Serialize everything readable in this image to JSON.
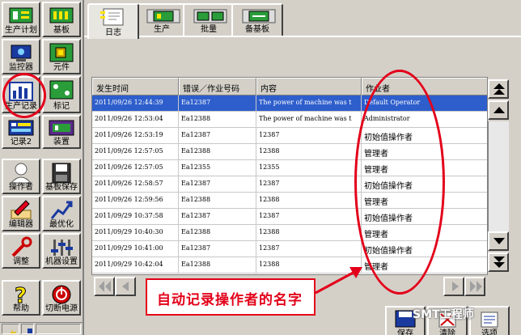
{
  "sidebar": {
    "buttons": [
      {
        "label": "生产计划",
        "icon": "production-plan-icon"
      },
      {
        "label": "基板",
        "icon": "board-icon"
      },
      {
        "label": "监控器",
        "icon": "monitor-icon"
      },
      {
        "label": "元件",
        "icon": "component-icon"
      },
      {
        "label": "生产记录",
        "icon": "production-record-icon"
      },
      {
        "label": "标记",
        "icon": "mark-icon"
      },
      {
        "label": "记录2",
        "icon": "record2-icon"
      },
      {
        "label": "装置",
        "icon": "device-icon"
      },
      {
        "label": "操作者",
        "icon": "operator-icon"
      },
      {
        "label": "基板保存",
        "icon": "save-board-icon"
      },
      {
        "label": "编辑器",
        "icon": "editor-icon"
      },
      {
        "label": "最优化",
        "icon": "optimize-icon"
      },
      {
        "label": "调整",
        "icon": "adjust-icon"
      },
      {
        "label": "机器设置",
        "icon": "machine-settings-icon"
      },
      {
        "label": "帮助",
        "icon": "help-icon"
      },
      {
        "label": "切断电源",
        "icon": "power-off-icon"
      }
    ]
  },
  "tabs": [
    {
      "label": "日志",
      "active": true
    },
    {
      "label": "生产",
      "active": false
    },
    {
      "label": "批量",
      "active": false
    },
    {
      "label": "备基板",
      "active": false
    }
  ],
  "grid": {
    "columns": [
      "发生时间",
      "错误／作业号码",
      "内容",
      "作业者"
    ],
    "rows": [
      {
        "time": "2011/09/26 12:44:39",
        "code": "Ea12387",
        "content": "The power of machine was t",
        "operator": "Default Operator",
        "selected": true
      },
      {
        "time": "2011/09/26 12:53:04",
        "code": "Ea12388",
        "content": "The power of machine was t",
        "operator": "Administrator",
        "selected": false
      },
      {
        "time": "2011/09/26 12:53:19",
        "code": "Ea12387",
        "content": "12387",
        "operator": "初始值操作者",
        "selected": false
      },
      {
        "time": "2011/09/26 12:57:05",
        "code": "Ea12388",
        "content": "12388",
        "operator": "管理者",
        "selected": false
      },
      {
        "time": "2011/09/26 12:57:05",
        "code": "Ea12355",
        "content": "12355",
        "operator": "管理者",
        "selected": false
      },
      {
        "time": "2011/09/26 12:58:57",
        "code": "Ea12387",
        "content": "12387",
        "operator": "初始值操作者",
        "selected": false
      },
      {
        "time": "2011/09/26 12:59:56",
        "code": "Ea12388",
        "content": "12388",
        "operator": "管理者",
        "selected": false
      },
      {
        "time": "2011/09/29 10:37:58",
        "code": "Ea12387",
        "content": "12387",
        "operator": "初始值操作者",
        "selected": false
      },
      {
        "time": "2011/09/29 10:40:30",
        "code": "Ea12388",
        "content": "12388",
        "operator": "管理者",
        "selected": false
      },
      {
        "time": "2011/09/29 10:41:00",
        "code": "Ea12387",
        "content": "12387",
        "operator": "初始值操作者",
        "selected": false
      },
      {
        "time": "2011/09/29 10:42:04",
        "code": "Ea12388",
        "content": "12388",
        "operator": "管理者",
        "selected": false
      }
    ]
  },
  "annotation": {
    "text": "自动记录操作者的名字",
    "color": "#e3001a"
  },
  "bottom_buttons": [
    {
      "label": "保存",
      "icon": "save-icon"
    },
    {
      "label": "清除",
      "icon": "clear-icon"
    },
    {
      "label": "选项",
      "icon": "options-icon"
    }
  ],
  "watermark": "SMT工程师",
  "colors": {
    "selection": "#2e5ecc",
    "panel": "#d4d0c8",
    "annotation": "#e3001a"
  }
}
